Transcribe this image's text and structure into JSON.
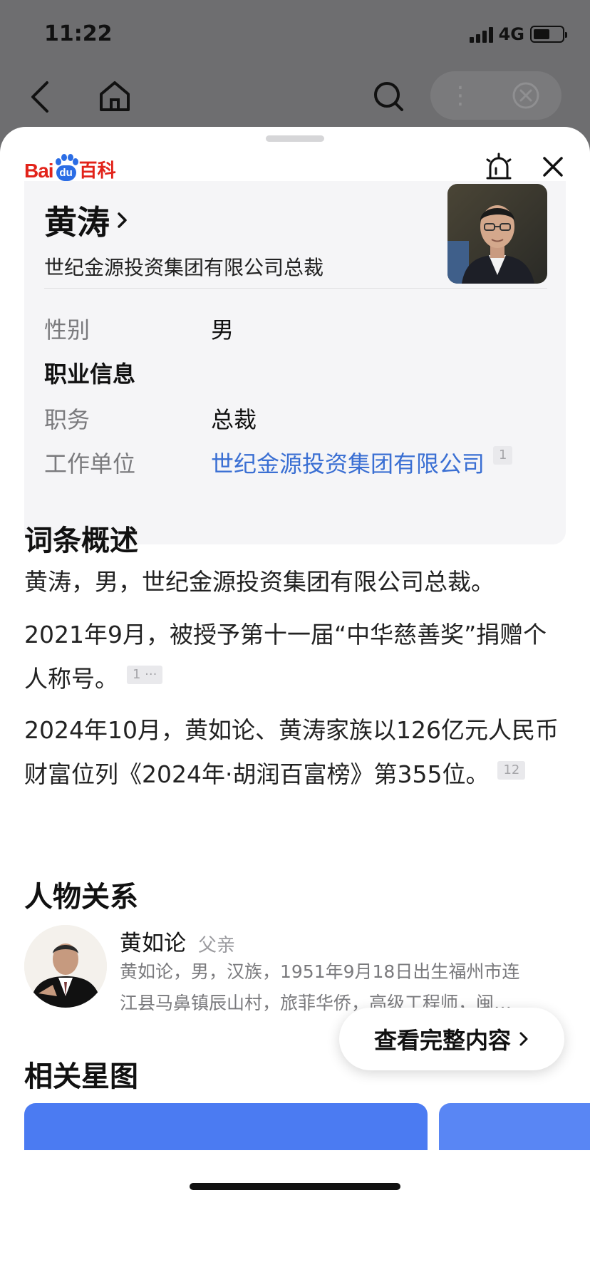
{
  "status_bar": {
    "time": "11:22",
    "network": "4G"
  },
  "header": {
    "logo_text_left": "Bai",
    "logo_text_paw": "du",
    "logo_text_right": "百科"
  },
  "person": {
    "name": "黄涛",
    "subtitle": "世纪金源投资集团有限公司总裁",
    "fields": {
      "gender_label": "性别",
      "gender_value": "男",
      "section_title": "职业信息",
      "position_label": "职务",
      "position_value": "总裁",
      "employer_label": "工作单位",
      "employer_value": "世纪金源投资集团有限公司",
      "employer_ref": "1"
    }
  },
  "overview": {
    "title": "词条概述",
    "p1": "黄涛，男，世纪金源投资集团有限公司总裁。",
    "p2": "2021年9月，被授予第十一届“中华慈善奖”捐赠个人称号。",
    "p2_ref": "1 ···",
    "p3": "2024年10月，黄如论、黄涛家族以126亿元人民币财富位列《2024年·胡润百富榜》第355位。",
    "p3_ref": "12"
  },
  "relations": {
    "title": "人物关系",
    "items": [
      {
        "name": "黄如论",
        "role": "父亲",
        "desc_line1": "黄如论，男，汉族，1951年9月18日出生福州市连",
        "desc_line2": "江县马鼻镇辰山村，旅菲华侨，高级工程师，闽…"
      }
    ]
  },
  "view_full_label": "查看完整内容",
  "star_map_title": "相关星图",
  "colors": {
    "accent_link": "#3a6fd3",
    "baidu_red": "#e2231a",
    "baidu_blue": "#2b6de5"
  }
}
